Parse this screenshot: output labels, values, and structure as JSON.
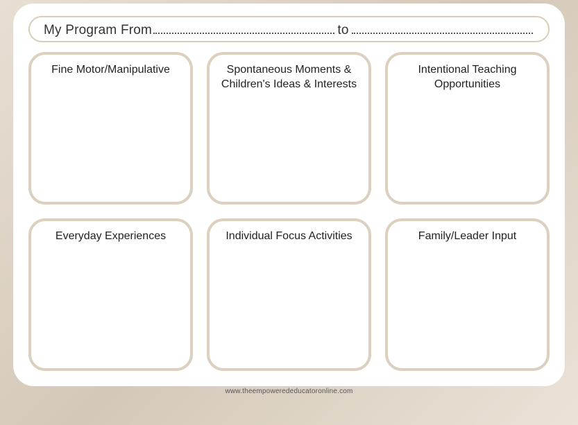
{
  "header": {
    "prefix": "My Program From",
    "to": "to"
  },
  "boxes": [
    {
      "label": "Fine Motor/Manipulative"
    },
    {
      "label": "Spontaneous Moments & Children's Ideas & Interests"
    },
    {
      "label": "Intentional Teaching Opportunities"
    },
    {
      "label": "Everyday Experiences"
    },
    {
      "label": "Individual Focus Activities"
    },
    {
      "label": "Family/Leader Input"
    }
  ],
  "footer": "www.theempowerededucatoronline.com"
}
